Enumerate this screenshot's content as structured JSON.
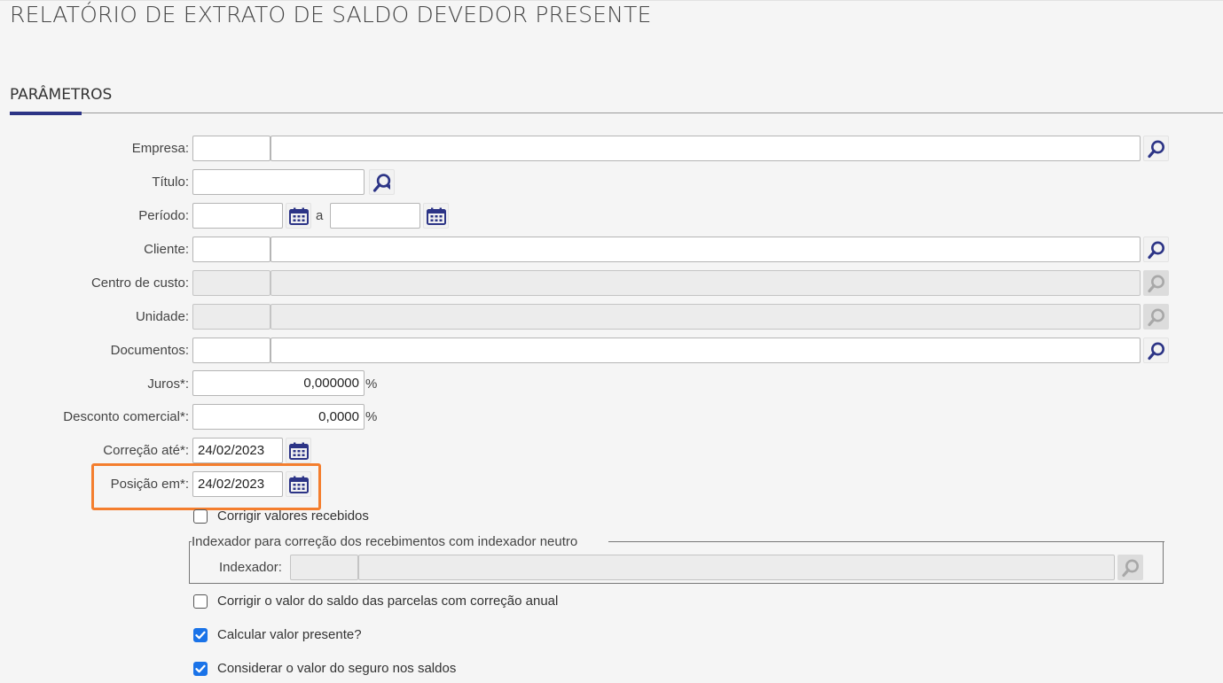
{
  "page": {
    "title": "RELATÓRIO DE EXTRATO DE SALDO DEVEDOR PRESENTE",
    "section": "PARÂMETROS"
  },
  "form": {
    "empresa": {
      "label": "Empresa:",
      "code": "",
      "desc": ""
    },
    "titulo": {
      "label": "Título:",
      "value": ""
    },
    "periodo": {
      "label": "Período:",
      "from": "",
      "sep": "a",
      "to": ""
    },
    "cliente": {
      "label": "Cliente:",
      "code": "",
      "desc": ""
    },
    "centro_custo": {
      "label": "Centro de custo:",
      "code": "",
      "desc": "",
      "disabled": true
    },
    "unidade": {
      "label": "Unidade:",
      "code": "",
      "desc": "",
      "disabled": true
    },
    "documentos": {
      "label": "Documentos:",
      "code": "",
      "desc": ""
    },
    "juros": {
      "label": "Juros*:",
      "value": "0,000000",
      "unit": "%"
    },
    "desconto": {
      "label": "Desconto comercial*:",
      "value": "0,0000",
      "unit": "%"
    },
    "correcao_ate": {
      "label": "Correção até*:",
      "value": "24/02/2023"
    },
    "posicao_em": {
      "label": "Posição em*:",
      "value": "24/02/2023"
    },
    "corrigir_recebidos": {
      "label": "Corrigir valores recebidos",
      "checked": false
    },
    "indexador_group": {
      "legend": "Indexador para correção dos recebimentos com indexador neutro",
      "label": "Indexador:",
      "code": "",
      "desc": "",
      "disabled": true
    },
    "correcao_anual": {
      "label": "Corrigir o valor do saldo das parcelas com correção anual",
      "checked": false
    },
    "valor_presente": {
      "label": "Calcular valor presente?",
      "checked": true
    },
    "seguro": {
      "label": "Considerar o valor do seguro nos saldos",
      "checked": true
    }
  },
  "colors": {
    "accent": "#2c3486",
    "highlight": "#f47e2e",
    "checkbox_checked": "#1a73e8"
  },
  "icons": {
    "lookup": "search-icon",
    "lookup_plus": "search-refresh-icon",
    "date": "calendar-icon"
  }
}
